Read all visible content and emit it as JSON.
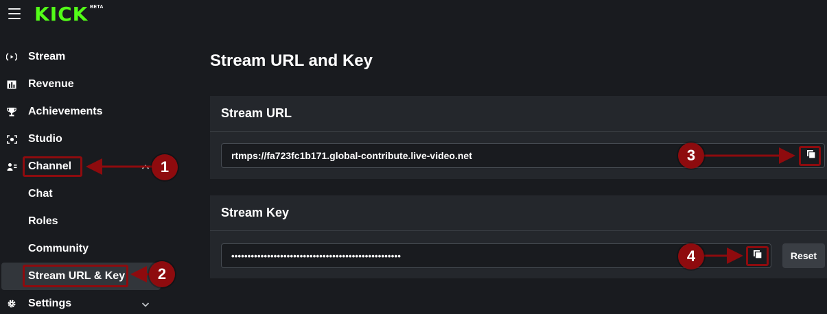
{
  "header": {
    "logo_text": "KICK",
    "beta_label": "BETA"
  },
  "sidebar": {
    "items": [
      {
        "label": "Stream",
        "icon": "stream-icon"
      },
      {
        "label": "Revenue",
        "icon": "revenue-icon"
      },
      {
        "label": "Achievements",
        "icon": "trophy-icon"
      },
      {
        "label": "Studio",
        "icon": "studio-icon"
      },
      {
        "label": "Channel",
        "icon": "channel-icon"
      },
      {
        "label": "Chat"
      },
      {
        "label": "Roles"
      },
      {
        "label": "Community"
      },
      {
        "label": "Stream URL & Key"
      },
      {
        "label": "Settings",
        "icon": "gear-icon"
      }
    ]
  },
  "main": {
    "title": "Stream URL and Key",
    "stream_url": {
      "heading": "Stream URL",
      "value": "rtmps://fa723fc1b171.global-contribute.live-video.net"
    },
    "stream_key": {
      "heading": "Stream Key",
      "value": "••••••••••••••••••••••••••••••••••••••••••••••••••••",
      "reset_label": "Reset"
    }
  },
  "annotations": {
    "callouts": [
      "1",
      "2",
      "3",
      "4"
    ],
    "color": "#8e0b0e"
  },
  "colors": {
    "brand": "#53fc18",
    "background": "#191b1f",
    "card": "#24272c",
    "active_item": "#32363b"
  }
}
